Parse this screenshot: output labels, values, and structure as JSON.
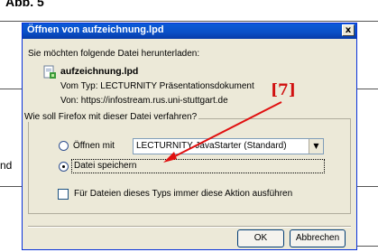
{
  "background": {
    "heading": "Abb. 5",
    "side_text": "nd"
  },
  "dialog": {
    "title": "Öffnen von aufzeichnung.lpd",
    "close_label": "x",
    "intro": "Sie möchten folgende Datei herunterladen:",
    "file_icon": "document-icon",
    "file_name": "aufzeichnung.lpd",
    "type_line": "Vom Typ:  LECTURNITY Präsentationsdokument",
    "from_line": "Von: https://infostream.rus.uni-stuttgart.de",
    "group_label": "Wie soll Firefox mit dieser Datei verfahren?",
    "open_with_label": "Öffnen mit",
    "open_with_app": "LECTURNITY JavaStarter (Standard)",
    "save_file_label": "Datei speichern",
    "selected_option": "save",
    "always_label": "Für Dateien dieses Typs immer diese Aktion ausführen",
    "always_checked": false,
    "ok_label": "OK",
    "cancel_label": "Abbrechen"
  },
  "annotation": {
    "label": "[7]",
    "color": "#d01010"
  },
  "colors": {
    "titlebar": "#0a5bd8",
    "dialog_bg": "#ece9d8"
  }
}
